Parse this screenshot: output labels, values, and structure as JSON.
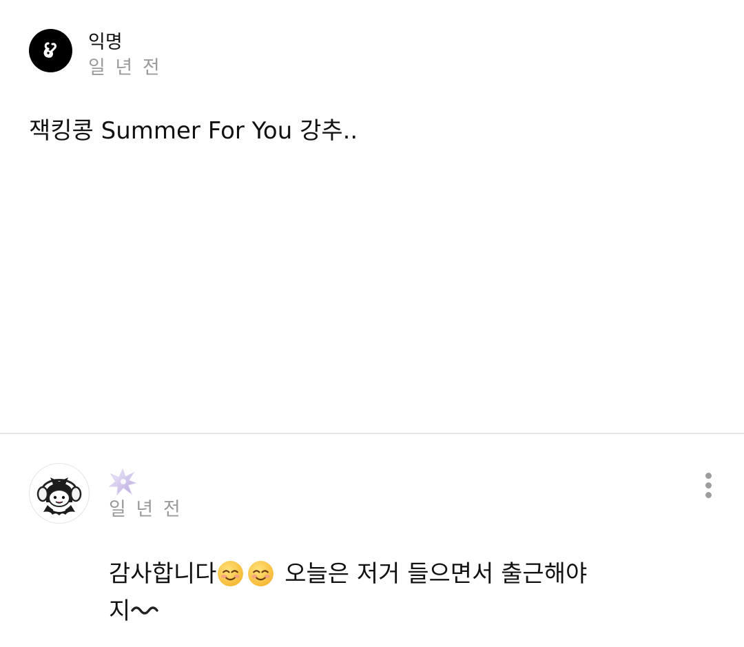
{
  "post": {
    "author": "익명",
    "time": "일 년 전",
    "avatar_icon": "anonymous-logo-icon",
    "body": "잭킹콩 Summer For You 강추.."
  },
  "comment": {
    "avatar_icon": "character-avatar-icon",
    "badge_icon": "sparkle-badge-icon",
    "time": "일 년 전",
    "more_icon": "more-vertical-icon",
    "text_line1": "감사합니다",
    "emoji": "smiling-face-icon",
    "text_line1_rest": " 오늘은 저거 들으면서 출근해야",
    "text_line2": "지",
    "trailing_icon": "wavy-dash-icon"
  },
  "colors": {
    "text": "#111111",
    "muted": "#9a9a9a",
    "divider": "#e6e6e6",
    "avatar_bg": "#000000"
  }
}
